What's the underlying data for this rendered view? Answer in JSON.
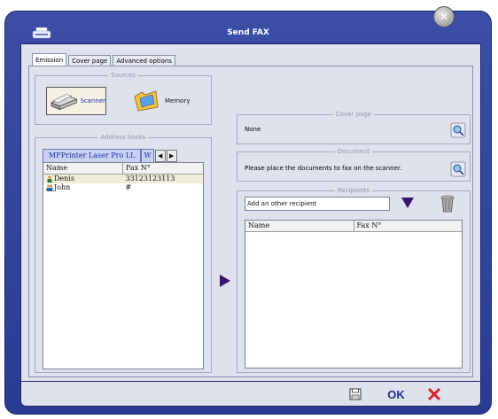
{
  "window": {
    "title": "Send FAX"
  },
  "tabs": [
    {
      "label": "Emission",
      "active": true
    },
    {
      "label": "Cover page",
      "active": false
    },
    {
      "label": "Advanced options",
      "active": false
    }
  ],
  "sources": {
    "title": "Sources",
    "items": [
      {
        "label": "Scanner",
        "icon": "scanner-icon",
        "selected": true
      },
      {
        "label": "Memory",
        "icon": "memory-folder-icon",
        "selected": false
      }
    ]
  },
  "address_books": {
    "title": "Address books",
    "tabs": [
      "MFPrinter Laser Pro LL",
      "W"
    ],
    "columns": [
      "Name",
      "Fax N°"
    ],
    "rows": [
      {
        "name": "Denis",
        "fax": "33123123113",
        "icon": "person-icon",
        "selected": true
      },
      {
        "name": "John",
        "fax": "#",
        "icon": "group-icon",
        "selected": false
      }
    ]
  },
  "cover_page": {
    "title": "Cover page",
    "value": "None"
  },
  "document": {
    "title": "Document",
    "value": "Please place the documents to fax on the scanner."
  },
  "recipients": {
    "title": "Recipients",
    "input_value": "Add an other recipient",
    "columns": [
      "Name",
      "Fax N°"
    ]
  },
  "colors": {
    "accent": "#2b3b93",
    "arrow": "#3a1670",
    "cancel": "#d8232a",
    "ok": "#1e2a8a"
  },
  "footer": {
    "ok_label": "OK"
  }
}
